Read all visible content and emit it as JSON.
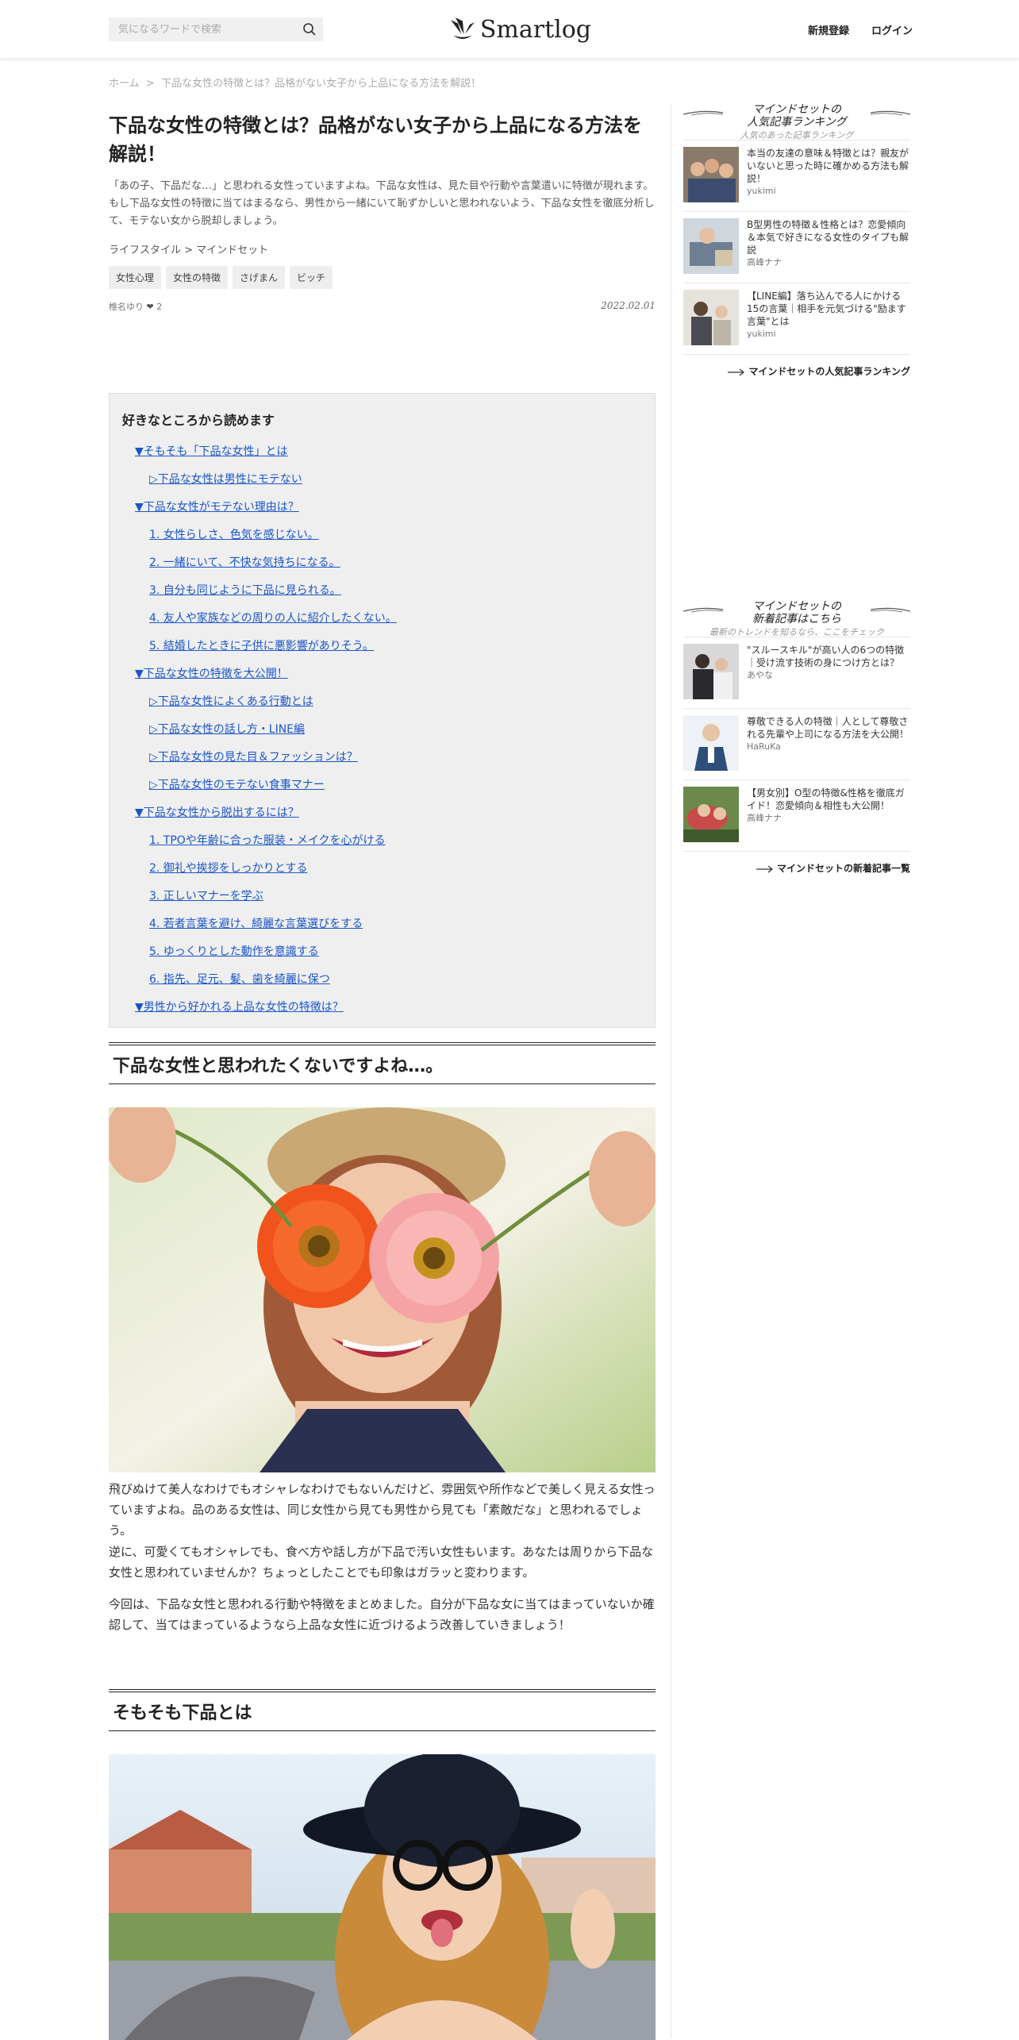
{
  "header": {
    "search_placeholder": "気になるワードで検索",
    "logo_text": "Smartlog",
    "signup": "新規登録",
    "login": "ログイン"
  },
  "breadcrumb": {
    "home": "ホーム",
    "separator": ">",
    "current": "下品な女性の特徴とは？品格がない女子から上品になる方法を解説！"
  },
  "article": {
    "title": "下品な女性の特徴とは？品格がない女子から上品になる方法を解説！",
    "lead": "「あの子、下品だな…」と思われる女性っていますよね。下品な女性は、見た目や行動や言葉遣いに特徴が現れます。もし下品な女性の特徴に当てはまるなら、男性から一緒にいて恥ずかしいと思われないよう、下品な女性を徹底分析して、モテない女から脱却しましょう。",
    "category": "ライフスタイル > マインドセット",
    "tags": [
      "女性心理",
      "女性の特徴",
      "さげまん",
      "ビッチ"
    ],
    "author": "椎名ゆり",
    "likes": "2",
    "date": "2022.02.01"
  },
  "toc": {
    "title": "好きなところから読めます",
    "items": [
      {
        "label": "▼そもそも「下品な女性」とは",
        "level": 1
      },
      {
        "label": "▷下品な女性は男性にモテない",
        "level": 2
      },
      {
        "label": "▼下品な女性がモテない理由は？",
        "level": 1
      },
      {
        "label": "1. 女性らしさ、色気を感じない。",
        "level": 2
      },
      {
        "label": "2. 一緒にいて、不快な気持ちになる。",
        "level": 2
      },
      {
        "label": "3. 自分も同じように下品に見られる。",
        "level": 2
      },
      {
        "label": "4. 友人や家族などの周りの人に紹介したくない。",
        "level": 2
      },
      {
        "label": "5. 結婚したときに子供に悪影響がありそう。",
        "level": 2
      },
      {
        "label": "▼下品な女性の特徴を大公開！",
        "level": 1
      },
      {
        "label": "▷下品な女性によくある行動とは",
        "level": 2
      },
      {
        "label": "▷下品な女性の話し方・LINE編",
        "level": 2
      },
      {
        "label": "▷下品な女性の見た目＆ファッションは？",
        "level": 2
      },
      {
        "label": "▷下品な女性のモテない食事マナー",
        "level": 2
      },
      {
        "label": "▼下品な女性から脱出するには？",
        "level": 1
      },
      {
        "label": "1. TPOや年齢に合った服装・メイクを心がける",
        "level": 2
      },
      {
        "label": "2. 御礼や挨拶をしっかりとする",
        "level": 2
      },
      {
        "label": "3. 正しいマナーを学ぶ",
        "level": 2
      },
      {
        "label": "4. 若者言葉を避け、綺麗な言葉選びをする",
        "level": 2
      },
      {
        "label": "5. ゆっくりとした動作を意識する",
        "level": 2
      },
      {
        "label": "6. 指先、足元、髪、歯を綺麗に保つ",
        "level": 2
      },
      {
        "label": "▼男性から好かれる上品な女性の特徴は？",
        "level": 1
      }
    ]
  },
  "sections": {
    "h1": "下品な女性と思われたくないですよね…。",
    "p1": "飛びぬけて美人なわけでもオシャレなわけでもないんだけど、雰囲気や所作などで美しく見える女性っていますよね。品のある女性は、同じ女性から見ても男性から見ても「素敵だな」と思われるでしょう。",
    "p2": "逆に、可愛くてもオシャレでも、食べ方や話し方が下品で汚い女性もいます。あなたは周りから下品な女性と思われていませんか？ちょっとしたことでも印象はガラッと変わります。",
    "p3": "今回は、下品な女性と思われる行動や特徴をまとめました。自分が下品な女に当てはまっていないか確認して、当てはまっているようなら上品な女性に近づけるよう改善していきましょう！",
    "h2": "そもそも下品とは"
  },
  "sidebar": {
    "ranking": {
      "title_line1": "マインドセットの",
      "title_line2": "人気記事ランキング",
      "subtitle": "人気のあった記事ランキング",
      "items": [
        {
          "title": "本当の友達の意味＆特徴とは？親友がいないと思った時に確かめる方法も解説！",
          "author": "yukimi"
        },
        {
          "title": "B型男性の特徴＆性格とは？恋愛傾向＆本気で好きになる女性のタイプも解説",
          "author": "高峰ナナ"
        },
        {
          "title": "【LINE編】落ち込んでる人にかける15の言葉｜相手を元気づける\"励ます言葉\"とは",
          "author": "yukimi"
        }
      ],
      "more": "マインドセットの人気記事ランキング"
    },
    "newest": {
      "title_line1": "マインドセットの",
      "title_line2": "新着記事はこちら",
      "subtitle": "最新のトレンドを知るなら、ここをチェック",
      "items": [
        {
          "title": "\"スルースキル\"が高い人の6つの特徴｜受け流す技術の身につけ方とは？",
          "author": "あやな"
        },
        {
          "title": "尊敬できる人の特徴｜人として尊敬される先輩や上司になる方法を大公開！",
          "author": "HaRuKa"
        },
        {
          "title": "【男女別】O型の特徴&性格を徹底ガイド！恋愛傾向＆相性も大公開！",
          "author": "高峰ナナ"
        }
      ],
      "more": "マインドセットの新着記事一覧"
    }
  }
}
